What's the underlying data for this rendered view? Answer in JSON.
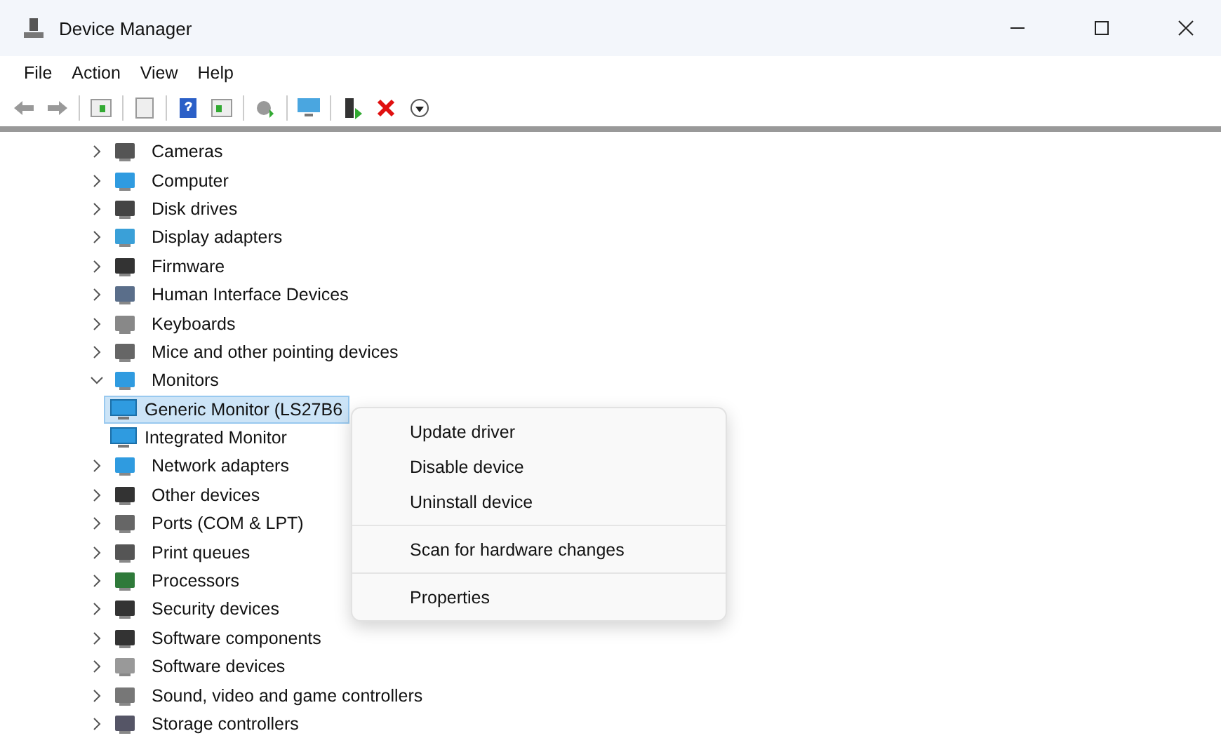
{
  "window": {
    "title": "Device Manager"
  },
  "menu": [
    "File",
    "Action",
    "View",
    "Help"
  ],
  "tree": [
    {
      "label": "Cameras",
      "expanded": false
    },
    {
      "label": "Computer",
      "expanded": false
    },
    {
      "label": "Disk drives",
      "expanded": false
    },
    {
      "label": "Display adapters",
      "expanded": false
    },
    {
      "label": "Firmware",
      "expanded": false
    },
    {
      "label": "Human Interface Devices",
      "expanded": false
    },
    {
      "label": "Keyboards",
      "expanded": false
    },
    {
      "label": "Mice and other pointing devices",
      "expanded": false
    },
    {
      "label": "Monitors",
      "expanded": true,
      "children": [
        {
          "label": "Generic Monitor (LS27B6",
          "selected": true
        },
        {
          "label": "Integrated Monitor",
          "selected": false
        }
      ]
    },
    {
      "label": "Network adapters",
      "expanded": false
    },
    {
      "label": "Other devices",
      "expanded": false
    },
    {
      "label": "Ports (COM & LPT)",
      "expanded": false
    },
    {
      "label": "Print queues",
      "expanded": false
    },
    {
      "label": "Processors",
      "expanded": false
    },
    {
      "label": "Security devices",
      "expanded": false
    },
    {
      "label": "Software components",
      "expanded": false
    },
    {
      "label": "Software devices",
      "expanded": false
    },
    {
      "label": "Sound, video and game controllers",
      "expanded": false
    },
    {
      "label": "Storage controllers",
      "expanded": false
    }
  ],
  "context_menu": [
    {
      "label": "Update driver",
      "kind": "item"
    },
    {
      "label": "Disable device",
      "kind": "item"
    },
    {
      "label": "Uninstall device",
      "kind": "item"
    },
    {
      "kind": "separator"
    },
    {
      "label": "Scan for hardware changes",
      "kind": "item"
    },
    {
      "kind": "separator"
    },
    {
      "label": "Properties",
      "kind": "item"
    }
  ]
}
